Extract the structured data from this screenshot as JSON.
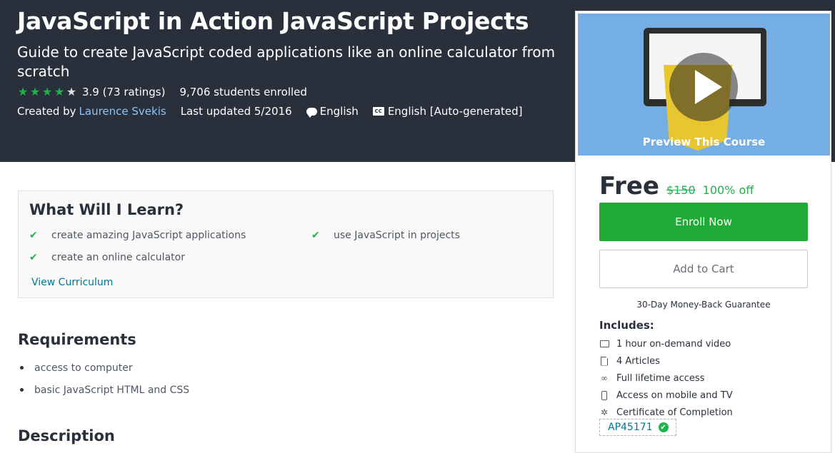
{
  "course": {
    "title": "JavaScript in Action JavaScript Projects",
    "subtitle": "Guide to create JavaScript coded applications like an online calculator from scratch",
    "rating": {
      "value": 3.9,
      "stars_full": 4,
      "stars_total": 5,
      "text": "3.9 (73 ratings)"
    },
    "enrolled": "9,706 students enrolled",
    "created_by_label": "Created by",
    "author": "Laurence Svekis",
    "last_updated": "Last updated 5/2016",
    "language": "English",
    "captions": "English [Auto-generated]"
  },
  "sidebar": {
    "preview_label": "Preview This Course",
    "price": "Free",
    "old_price": "$150",
    "discount": "100% off",
    "enroll_label": "Enroll Now",
    "cart_label": "Add to Cart",
    "guarantee": "30-Day Money-Back Guarantee",
    "includes_title": "Includes:",
    "includes": [
      {
        "icon": "video-icon",
        "label": "1 hour on-demand video"
      },
      {
        "icon": "file-icon",
        "label": "4 Articles"
      },
      {
        "icon": "infinity-icon",
        "label": "Full lifetime access"
      },
      {
        "icon": "mobile-icon",
        "label": "Access on mobile and TV"
      },
      {
        "icon": "certificate-icon",
        "label": "Certificate of Completion"
      }
    ],
    "coupon_code": "AP45171"
  },
  "learn": {
    "title": "What Will I Learn?",
    "items": [
      "create amazing JavaScript applications",
      "use JavaScript in projects",
      "create an online calculator"
    ],
    "view_curriculum": "View Curriculum"
  },
  "requirements": {
    "title": "Requirements",
    "items": [
      "access to computer",
      "basic JavaScript HTML and CSS"
    ]
  },
  "description": {
    "title": "Description"
  },
  "colors": {
    "hero_bg": "#29303b",
    "accent_green": "#1eb44d",
    "enroll_green": "#1fab35",
    "link_blue": "#007791",
    "author_link": "#8dc3f8"
  }
}
